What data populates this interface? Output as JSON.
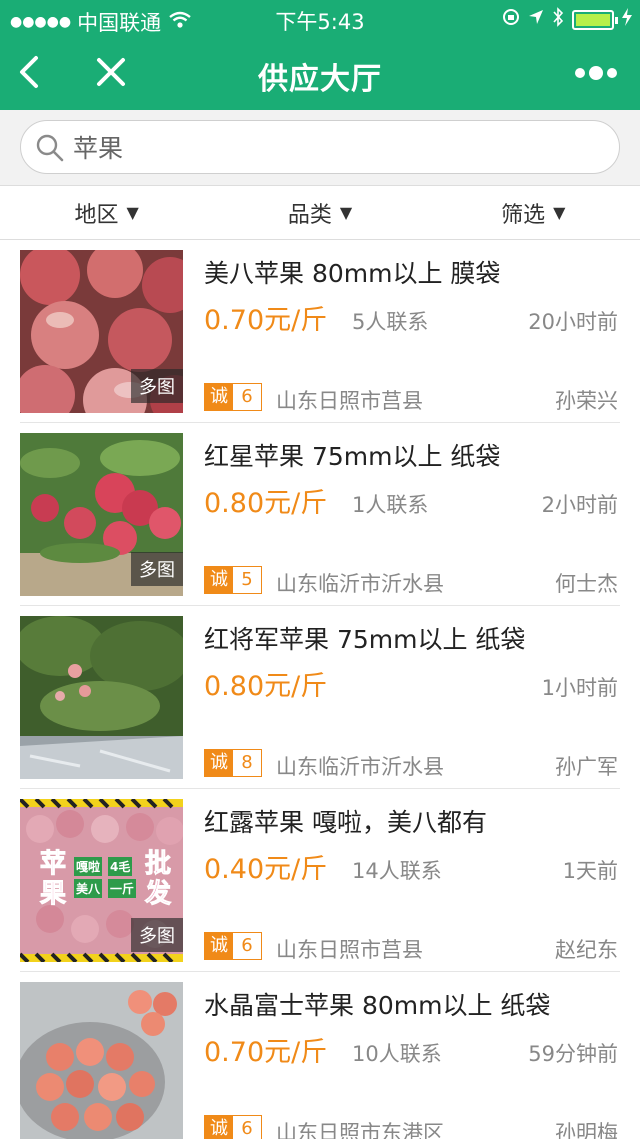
{
  "status_bar": {
    "carrier": "中国联通",
    "time": "下午5:43"
  },
  "nav": {
    "title": "供应大厅"
  },
  "search": {
    "value": "苹果"
  },
  "filters": [
    {
      "label": "地区"
    },
    {
      "label": "品类"
    },
    {
      "label": "筛选"
    }
  ],
  "listings": [
    {
      "title": "美八苹果 80mm以上 膜袋",
      "price": "0.70元/斤",
      "contacts": "5人联系",
      "time": "20小时前",
      "badge_label": "诚",
      "badge_level": "6",
      "location": "山东日照市莒县",
      "seller": "孙荣兴",
      "multi_image": "多图"
    },
    {
      "title": "红星苹果 75mm以上 纸袋",
      "price": "0.80元/斤",
      "contacts": "1人联系",
      "time": "2小时前",
      "badge_label": "诚",
      "badge_level": "5",
      "location": "山东临沂市沂水县",
      "seller": "何士杰",
      "multi_image": "多图"
    },
    {
      "title": "红将军苹果 75mm以上 纸袋",
      "price": "0.80元/斤",
      "contacts": "",
      "time": "1小时前",
      "badge_label": "诚",
      "badge_level": "8",
      "location": "山东临沂市沂水县",
      "seller": "孙广军",
      "multi_image": ""
    },
    {
      "title": "红露苹果 嘎啦，美八都有",
      "price": "0.40元/斤",
      "contacts": "14人联系",
      "time": "1天前",
      "badge_label": "诚",
      "badge_level": "6",
      "location": "山东日照市莒县",
      "seller": "赵纪东",
      "multi_image": "多图",
      "image_text": [
        "苹",
        "果",
        "嘎啦",
        "4毛",
        "美八",
        "一斤",
        "批",
        "发"
      ]
    },
    {
      "title": "水晶富士苹果 80mm以上 纸袋",
      "price": "0.70元/斤",
      "contacts": "10人联系",
      "time": "59分钟前",
      "badge_label": "诚",
      "badge_level": "6",
      "location": "山东日照市东港区",
      "seller": "孙明梅",
      "multi_image": ""
    }
  ],
  "colors": {
    "brand": "#1aad75",
    "price": "#f08a18"
  }
}
